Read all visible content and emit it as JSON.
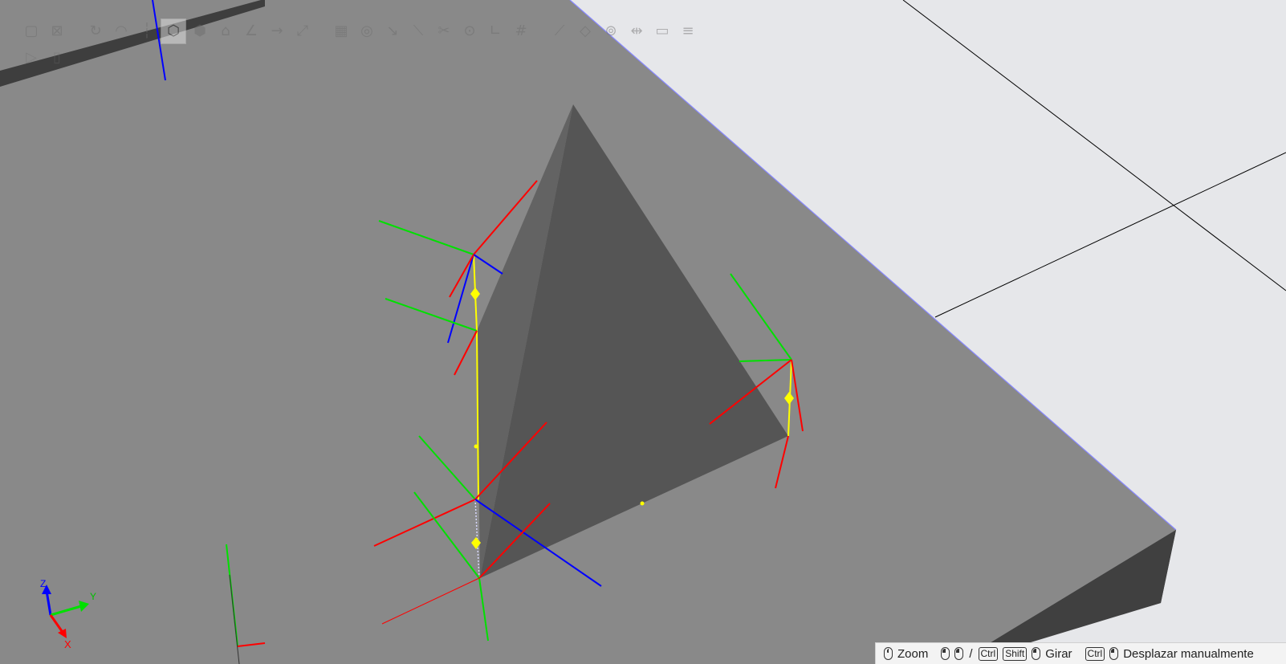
{
  "statusbar": {
    "zoom_label": "Zoom",
    "rotate_label": "Girar",
    "pan_label": "Desplazar manualmente",
    "key_ctrl": "Ctrl",
    "key_shift": "Shift",
    "separator": "/"
  },
  "axis_triad": {
    "x": "X",
    "y": "Y",
    "z": "Z"
  },
  "toolbar": {
    "icons": [
      "select-box-icon",
      "select-cross-icon",
      "rotate-view-icon",
      "pan-view-icon",
      "move-icon",
      "view-cube-icon",
      "part-icon",
      "tag-icon",
      "measure-angle-icon",
      "arrow-icon",
      "scale-icon",
      "grid-icon",
      "target-icon",
      "pointer-icon",
      "line-tool-icon",
      "cut-icon",
      "circle-target-icon",
      "corner-icon",
      "hash-icon",
      "diagonal-icon",
      "frame-icon",
      "gear-target-icon",
      "bracket-icon",
      "ruler-icon",
      "align-icon"
    ],
    "active_icon": "view-cube-icon"
  },
  "colors": {
    "background": "#e6e7ea",
    "table_top": "#898989",
    "table_side": "#404040",
    "pyramid_dark": "#555555",
    "pyramid_light": "#636363",
    "axis_x": "#ff0000",
    "axis_y": "#00e000",
    "axis_z": "#0000ff",
    "path": "#ffff00"
  }
}
